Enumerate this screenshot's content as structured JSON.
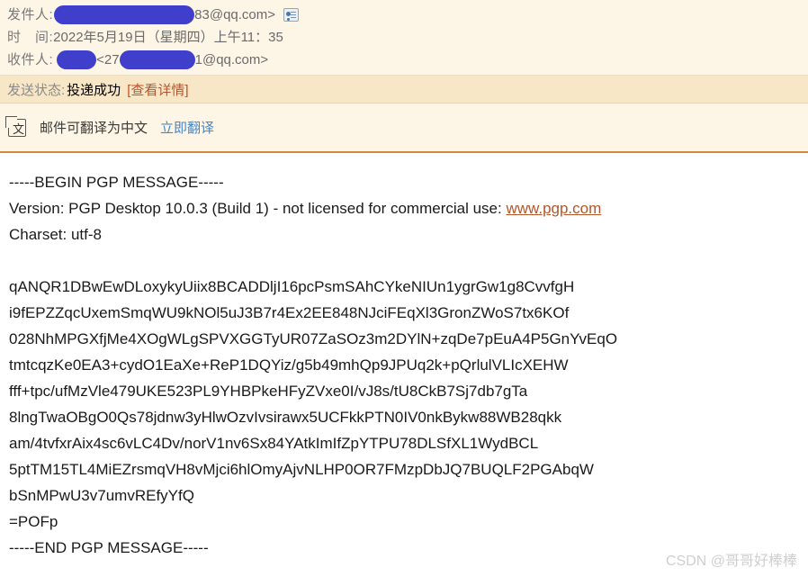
{
  "header": {
    "sender": {
      "label": "发件人:",
      "redacted": true,
      "email_suffix": "83@qq.com>",
      "contact_icon": "contact-card-icon"
    },
    "time": {
      "label": "时　间:",
      "value": "2022年5月19日（星期四）上午11：35"
    },
    "recipient": {
      "label": "收件人:",
      "redacted_name": true,
      "bracket_open": "<27",
      "redacted_addr": true,
      "email_suffix": "1@qq.com>"
    }
  },
  "status": {
    "label": "发送状态:",
    "value": "投递成功",
    "detail_link": "[查看详情]",
    "bar_bg": "#f8e7c6",
    "link_color": "#c0522b"
  },
  "translate": {
    "icon": "translate-icon",
    "icon_glyph": "文",
    "text": "邮件可翻译为中文",
    "action_link": "立即翻译",
    "bar_bg": "#fdf5e5",
    "link_color": "#4a86c8",
    "border_color": "#d4873b"
  },
  "pgp": {
    "begin": "-----BEGIN PGP MESSAGE-----",
    "version_prefix": "Version: PGP Desktop 10.0.3 (Build 1) - not licensed for commercial use: ",
    "version_link": "www.pgp.com",
    "charset": "Charset: utf-8",
    "body_lines": [
      "qANQR1DBwEwDLoxykyUiix8BCADDljI16pcPsmSAhCYkeNIUn1ygrGw1g8CvvfgH",
      "i9fEPZZqcUxemSmqWU9kNOl5uJ3B7r4Ex2EE848NJciFEqXl3GronZWoS7tx6KOf",
      "028NhMPGXfjMe4XOgWLgSPVXGGTyUR07ZaSOz3m2DYlN+zqDe7pEuA4P5GnYvEqO",
      "tmtcqzKe0EA3+cydO1EaXe+ReP1DQYiz/g5b49mhQp9JPUq2k+pQrlulVLIcXEHW",
      "fff+tpc/ufMzVle479UKE523PL9YHBPkeHFyZVxe0I/vJ8s/tU8CkB7Sj7db7gTa",
      "8lngTwaOBgO0Qs78jdnw3yHlwOzvIvsirawx5UCFkkPTN0IV0nkBykw88WB28qkk",
      "am/4tvfxrAix4sc6vLC4Dv/norV1nv6Sx84YAtkImIfZpYTPU78DLSfXL1WydBCL",
      "5ptTM15TL4MiEZrsmqVH8vMjci6hlOmyAjvNLHP0OR7FMzpDbJQ7BUQLF2PGAbqW",
      "bSnMPwU3v7umvREfyYfQ",
      "=POFp"
    ],
    "end": "-----END PGP MESSAGE-----",
    "link_color": "#b4552a"
  },
  "watermark": {
    "text": "CSDN @哥哥好棒棒",
    "color": "#cfcfcf"
  }
}
